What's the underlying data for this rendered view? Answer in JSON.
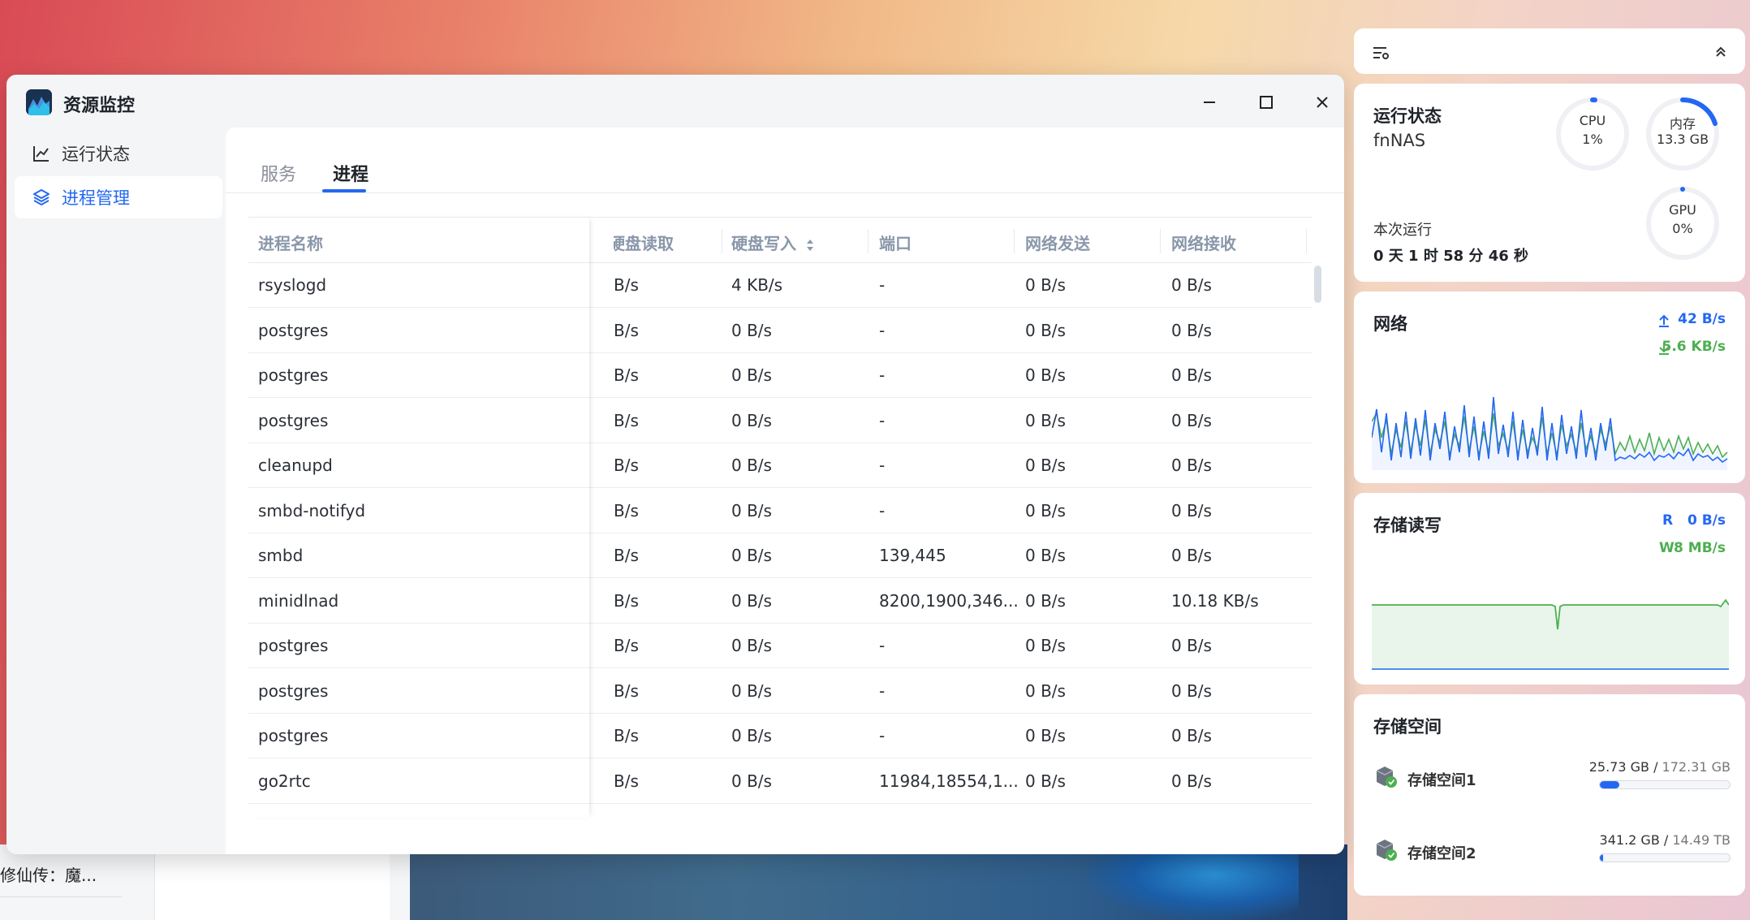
{
  "window": {
    "title": "资源监控"
  },
  "sidebar": {
    "items": [
      {
        "label": "运行状态",
        "icon": "chart-line-icon",
        "active": false
      },
      {
        "label": "进程管理",
        "icon": "layers-icon",
        "active": true
      }
    ]
  },
  "tabs": [
    {
      "label": "服务",
      "active": false
    },
    {
      "label": "进程",
      "active": true
    }
  ],
  "table": {
    "columns": [
      "进程名称",
      "硬盘读取",
      "硬盘写入",
      "端口",
      "网络发送",
      "网络接收"
    ],
    "rows": [
      [
        "rsyslogd",
        "B/s",
        "4 KB/s",
        "-",
        "0 B/s",
        "0 B/s"
      ],
      [
        "postgres",
        "B/s",
        "0 B/s",
        "-",
        "0 B/s",
        "0 B/s"
      ],
      [
        "postgres",
        "B/s",
        "0 B/s",
        "-",
        "0 B/s",
        "0 B/s"
      ],
      [
        "postgres",
        "B/s",
        "0 B/s",
        "-",
        "0 B/s",
        "0 B/s"
      ],
      [
        "cleanupd",
        "B/s",
        "0 B/s",
        "-",
        "0 B/s",
        "0 B/s"
      ],
      [
        "smbd-notifyd",
        "B/s",
        "0 B/s",
        "-",
        "0 B/s",
        "0 B/s"
      ],
      [
        "smbd",
        "B/s",
        "0 B/s",
        "139,445",
        "0 B/s",
        "0 B/s"
      ],
      [
        "minidlnad",
        "B/s",
        "0 B/s",
        "8200,1900,346...",
        "0 B/s",
        "10.18 KB/s"
      ],
      [
        "postgres",
        "B/s",
        "0 B/s",
        "-",
        "0 B/s",
        "0 B/s"
      ],
      [
        "postgres",
        "B/s",
        "0 B/s",
        "-",
        "0 B/s",
        "0 B/s"
      ],
      [
        "postgres",
        "B/s",
        "0 B/s",
        "-",
        "0 B/s",
        "0 B/s"
      ],
      [
        "go2rtc",
        "B/s",
        "0 B/s",
        "11984,18554,1...",
        "0 B/s",
        "0 B/s"
      ]
    ]
  },
  "widgets": {
    "status": {
      "title": "运行状态",
      "host": "fnNAS",
      "uptime_label": "本次运行",
      "uptime": "0 天 1 时 58 分 46 秒",
      "cpu": {
        "label": "CPU",
        "value": "1%",
        "fraction": 0.01
      },
      "mem": {
        "label": "内存",
        "value": "13.3 GB",
        "fraction": 0.2
      },
      "gpu": {
        "label": "GPU",
        "value": "0%",
        "fraction": 0
      }
    },
    "network": {
      "title": "网络",
      "up": "42 B/s",
      "down": "5.6 KB/s",
      "up_color": "#2468f2",
      "down_color": "#4caf50"
    },
    "storage_io": {
      "title": "存储读写",
      "read_label": "R",
      "read": "0 B/s",
      "write_label": "W",
      "write": "8 MB/s"
    },
    "storage_space": {
      "title": "存储空间",
      "items": [
        {
          "name": "存储空间1",
          "used": "25.73 GB",
          "total": "172.31 GB",
          "fraction": 0.149
        },
        {
          "name": "存储空间2",
          "used": "341.2 GB",
          "total": "14.49 TB",
          "fraction": 0.023
        }
      ]
    }
  },
  "background": {
    "lines": [
      "修仙传：魔..."
    ]
  }
}
